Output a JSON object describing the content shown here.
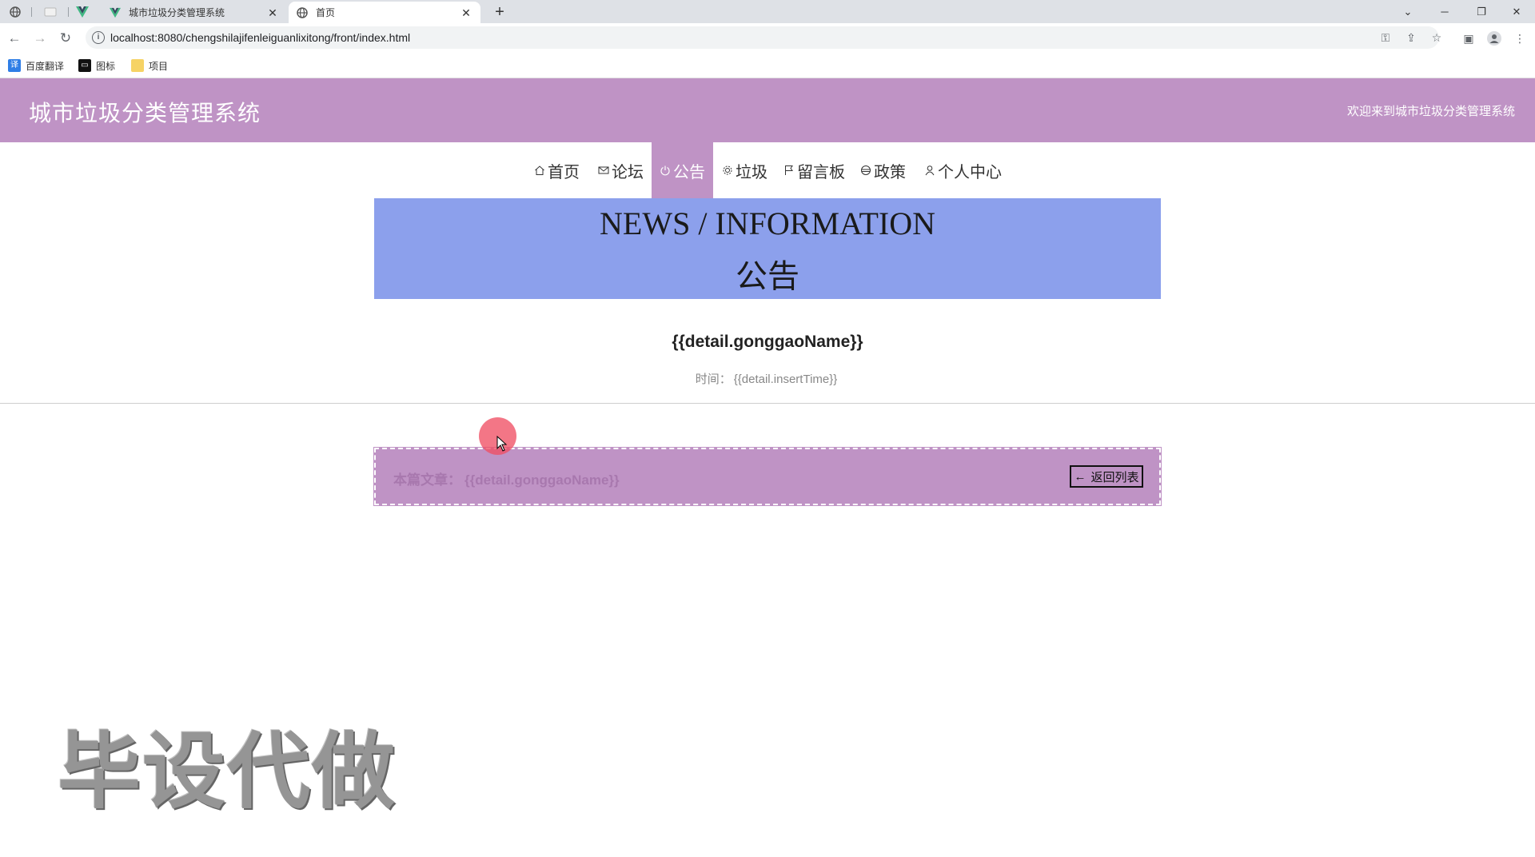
{
  "browser": {
    "tabs": [
      {
        "title": "城市垃圾分类管理系统",
        "active": false
      },
      {
        "title": "首页",
        "active": true
      }
    ],
    "url": "localhost:8080/chengshilajifenleiguanlixitong/front/index.html",
    "bookmarks": [
      {
        "label": "百度翻译",
        "icon": "translate-icon"
      },
      {
        "label": "图标",
        "icon": "image-icon"
      },
      {
        "label": "项目",
        "icon": "folder-icon"
      }
    ]
  },
  "header": {
    "title": "城市垃圾分类管理系统",
    "welcome": "欢迎来到城市垃圾分类管理系统"
  },
  "nav": {
    "items": [
      {
        "label": "首页",
        "icon": "home-icon",
        "active": false
      },
      {
        "label": "论坛",
        "icon": "mail-icon",
        "active": false
      },
      {
        "label": "公告",
        "icon": "power-icon",
        "active": true
      },
      {
        "label": "垃圾",
        "icon": "gear-icon",
        "active": false
      },
      {
        "label": "留言板",
        "icon": "flag-icon",
        "active": false
      },
      {
        "label": "政策",
        "icon": "disc-icon",
        "active": false
      },
      {
        "label": "个人中心",
        "icon": "user-icon",
        "active": false
      }
    ]
  },
  "banner": {
    "en": "NEWS / INFORMATION",
    "cn": "公告"
  },
  "detail": {
    "title": "{{detail.gonggaoName}}",
    "time_label": "时间：",
    "time_value": "{{detail.insertTime}}"
  },
  "article_bar": {
    "current_label": "本篇文章：",
    "current_value": "{{detail.gonggaoName}}",
    "back_label": "返回列表"
  },
  "watermark": "毕设代做",
  "colors": {
    "accent": "#bf93c5",
    "banner": "#8ca0ec"
  }
}
